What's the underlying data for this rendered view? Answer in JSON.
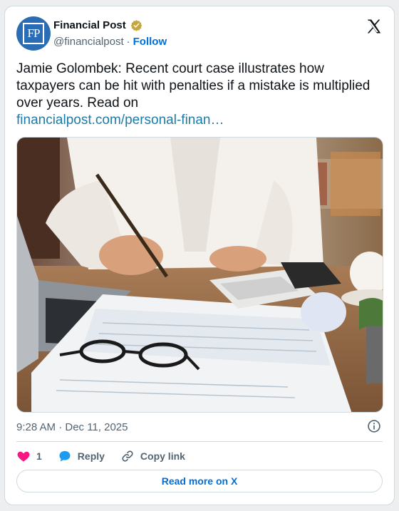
{
  "author": {
    "name": "Financial Post",
    "handle": "@financialpost",
    "separator": "·",
    "follow_label": "Follow",
    "avatar_text": "FP",
    "verified_color": "#c8a63a"
  },
  "tweet": {
    "text": "Jamie Golombek: Recent court case illustrates how taxpayers can be hit with penalties if a mistake is multiplied over years. Read on",
    "link_text": "financialpost.com/personal-finan…",
    "timestamp": "9:28 AM · Dec 11, 2025"
  },
  "actions": {
    "likes_count": "1",
    "reply_label": "Reply",
    "copy_link_label": "Copy link"
  },
  "footer": {
    "read_more_label": "Read more on X"
  },
  "colors": {
    "link": "#1d7ba8",
    "follow": "#006fd6",
    "heart": "#f91880",
    "reply": "#1d9bf0",
    "avatar_bg": "#2a6db5"
  },
  "icons": [
    "verified-badge-icon",
    "x-logo-icon",
    "info-icon",
    "heart-icon",
    "reply-bubble-icon",
    "link-chain-icon"
  ]
}
